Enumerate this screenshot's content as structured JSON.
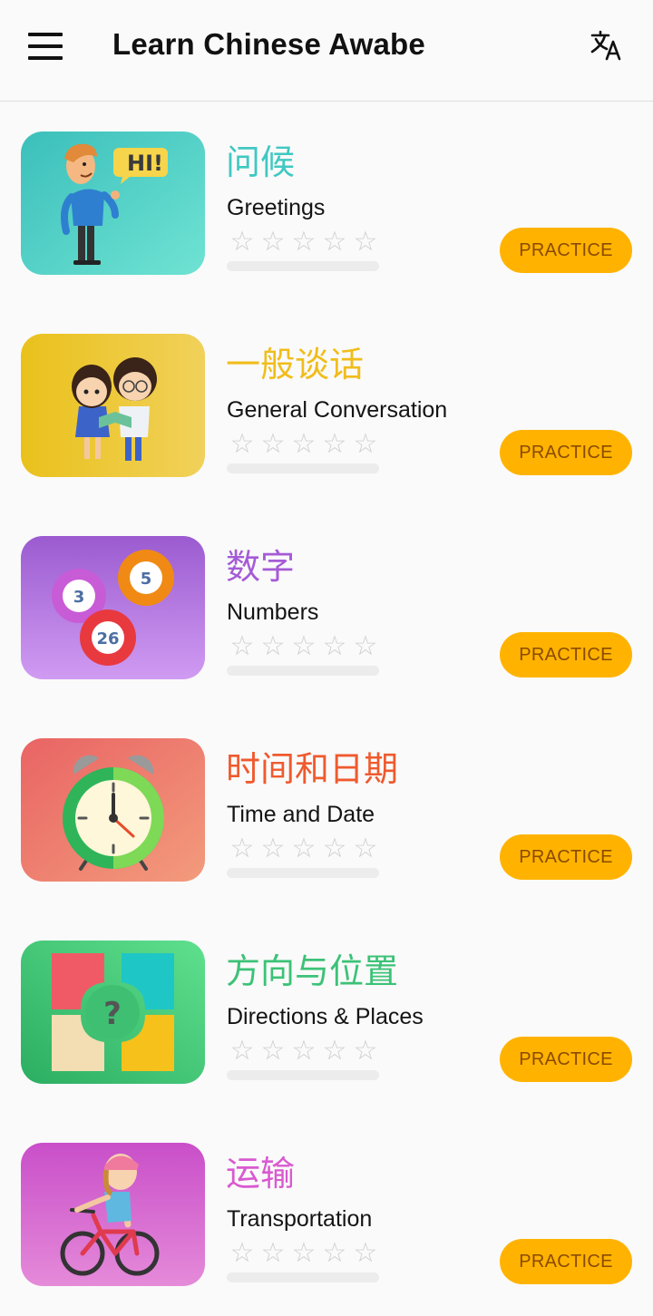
{
  "app": {
    "title": "Learn Chinese Awabe",
    "menu_icon": "hamburger-menu-icon",
    "translate_icon": "translate-icon"
  },
  "lessons": [
    {
      "chinese": "问候",
      "english": "Greetings",
      "color": "#40c8c2",
      "stars": 0,
      "progress": 0,
      "button": "PRACTICE",
      "icon": "greeting-man-hi-icon",
      "bubble_text": "HI!"
    },
    {
      "chinese": "一般谈话",
      "english": "General Conversation",
      "color": "#f0bd1c",
      "stars": 0,
      "progress": 0,
      "button": "PRACTICE",
      "icon": "two-kids-reading-icon"
    },
    {
      "chinese": "数字",
      "english": "Numbers",
      "color": "#a55bd6",
      "stars": 0,
      "progress": 0,
      "button": "PRACTICE",
      "icon": "number-balls-icon",
      "balls": [
        "3",
        "5",
        "26"
      ]
    },
    {
      "chinese": "时间和日期",
      "english": "Time and Date",
      "color": "#ef5a2e",
      "stars": 0,
      "progress": 0,
      "button": "PRACTICE",
      "icon": "alarm-clock-icon"
    },
    {
      "chinese": "方向与位置",
      "english": "Directions & Places",
      "color": "#3cc277",
      "stars": 0,
      "progress": 0,
      "button": "PRACTICE",
      "icon": "directions-arrows-icon",
      "center_mark": "?"
    },
    {
      "chinese": "运输",
      "english": "Transportation",
      "color": "#d95ad0",
      "stars": 0,
      "progress": 0,
      "button": "PRACTICE",
      "icon": "girl-on-bicycle-icon"
    }
  ],
  "star_glyph": "☆",
  "max_stars": 5
}
